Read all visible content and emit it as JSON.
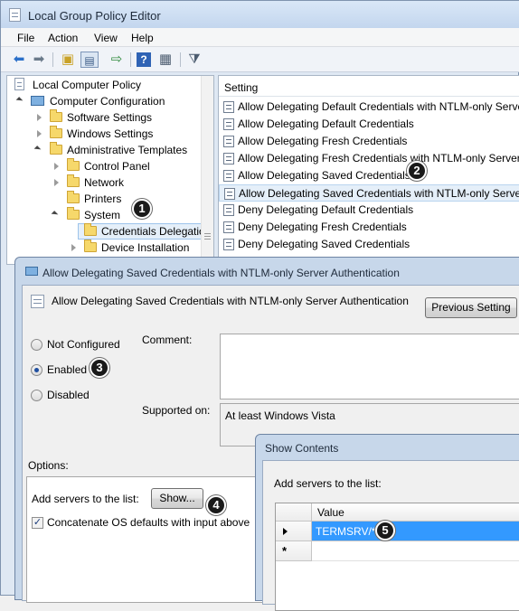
{
  "main_window": {
    "title": "Local Group Policy Editor",
    "menu": [
      "File",
      "Action",
      "View",
      "Help"
    ],
    "toolbar_icons": [
      "back-arrow-icon",
      "forward-arrow-icon",
      "up-folder-icon",
      "show-hide-tree-icon",
      "export-list-icon",
      "help-icon",
      "properties-icon",
      "filter-icon"
    ]
  },
  "tree": {
    "items": [
      {
        "label": "Local Computer Policy"
      },
      {
        "label": "Computer Configuration"
      },
      {
        "label": "Software Settings"
      },
      {
        "label": "Windows Settings"
      },
      {
        "label": "Administrative Templates"
      },
      {
        "label": "Control Panel"
      },
      {
        "label": "Network"
      },
      {
        "label": "Printers"
      },
      {
        "label": "System"
      },
      {
        "label": "Credentials Delegation"
      },
      {
        "label": "Device Installation"
      }
    ]
  },
  "list": {
    "column": "Setting",
    "rows": [
      "Allow Delegating Default Credentials with NTLM-only Server Authentication",
      "Allow Delegating Default Credentials",
      "Allow Delegating Fresh Credentials",
      "Allow Delegating Fresh Credentials with NTLM-only Server Authentication",
      "Allow Delegating Saved Credentials",
      "Allow Delegating Saved Credentials with NTLM-only Server Authentication",
      "Deny Delegating Default Credentials",
      "Deny Delegating Fresh Credentials",
      "Deny Delegating Saved Credentials"
    ],
    "selected_index": 5
  },
  "callouts": [
    "1",
    "2",
    "3",
    "4",
    "5"
  ],
  "setting_dialog": {
    "title": "Allow Delegating Saved Credentials with NTLM-only Server Authentication",
    "heading": "Allow Delegating Saved Credentials with NTLM-only Server Authentication",
    "previous_button": "Previous Setting",
    "options": [
      {
        "label": "Not Configured",
        "selected": false
      },
      {
        "label": "Enabled",
        "selected": true
      },
      {
        "label": "Disabled",
        "selected": false
      }
    ],
    "comment_label": "Comment:",
    "supported_label": "Supported on:",
    "supported_value": "At least Windows Vista",
    "options_label": "Options:",
    "add_servers_label": "Add servers to the list:",
    "show_button": "Show...",
    "concatenate_label": "Concatenate OS defaults with input above",
    "concatenate_checked": true
  },
  "show_contents": {
    "title": "Show Contents",
    "instruction": "Add servers to the list:",
    "column": "Value",
    "rows": [
      "TERMSRV/*"
    ],
    "new_row_marker": "*"
  },
  "colors": {
    "selection_blue": "#3399ff",
    "title_bar": "#c3d6ee"
  }
}
